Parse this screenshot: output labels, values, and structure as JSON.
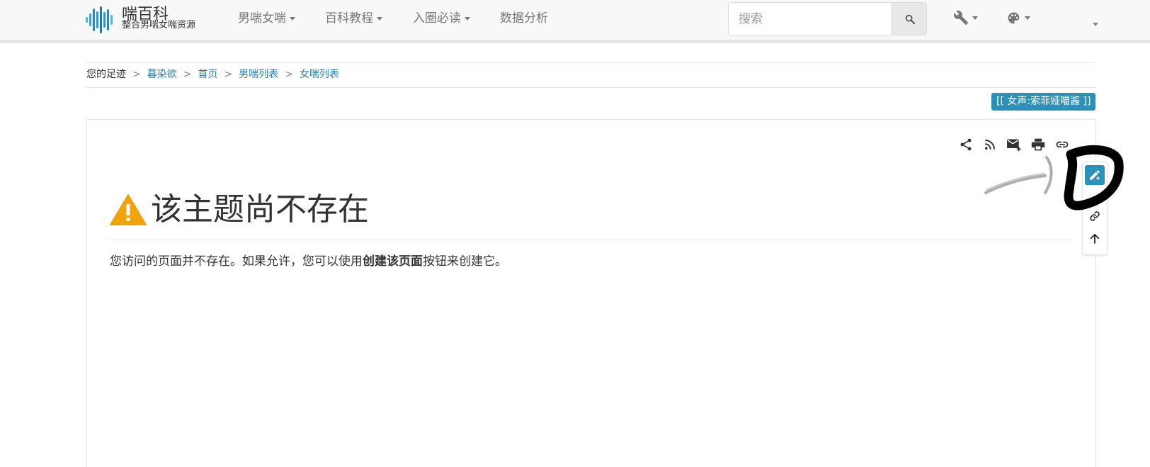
{
  "navbar": {
    "brand_title": "喘百科",
    "brand_subtitle": "整合男喘女喘资源",
    "menu": [
      {
        "label": "男喘女喘",
        "dropdown": true
      },
      {
        "label": "百科教程",
        "dropdown": true
      },
      {
        "label": "入圈必读",
        "dropdown": true
      },
      {
        "label": "数据分析",
        "dropdown": false
      }
    ],
    "search_placeholder": "搜索",
    "icons": {
      "search": "search-icon",
      "tools": "wrench-icon",
      "theme": "palette-icon",
      "user": "chevron-down-icon"
    }
  },
  "breadcrumb": {
    "lead": "您的足迹",
    "separator": ">",
    "items": [
      "暮染欲",
      "首页",
      "男喘列表",
      "女喘列表"
    ]
  },
  "tag_badge": "[[ 女声:索菲娅喵酱 ]]",
  "page_tools": [
    "share-icon",
    "rss-icon",
    "mail-icon",
    "print-icon",
    "link-icon"
  ],
  "side_tools": [
    "edit-icon",
    "link-icon",
    "arrow-up-icon"
  ],
  "page": {
    "title": "该主题尚不存在",
    "message_before": "您访问的页面并不存在。如果允许，您可以使用",
    "message_bold": "创建该页面",
    "message_after": "按钮来创建它。"
  },
  "colors": {
    "accent": "#2b91b9",
    "link": "#2b7ea1",
    "warning": "#f0a30a",
    "navbar_bg": "#f8f8f8"
  }
}
